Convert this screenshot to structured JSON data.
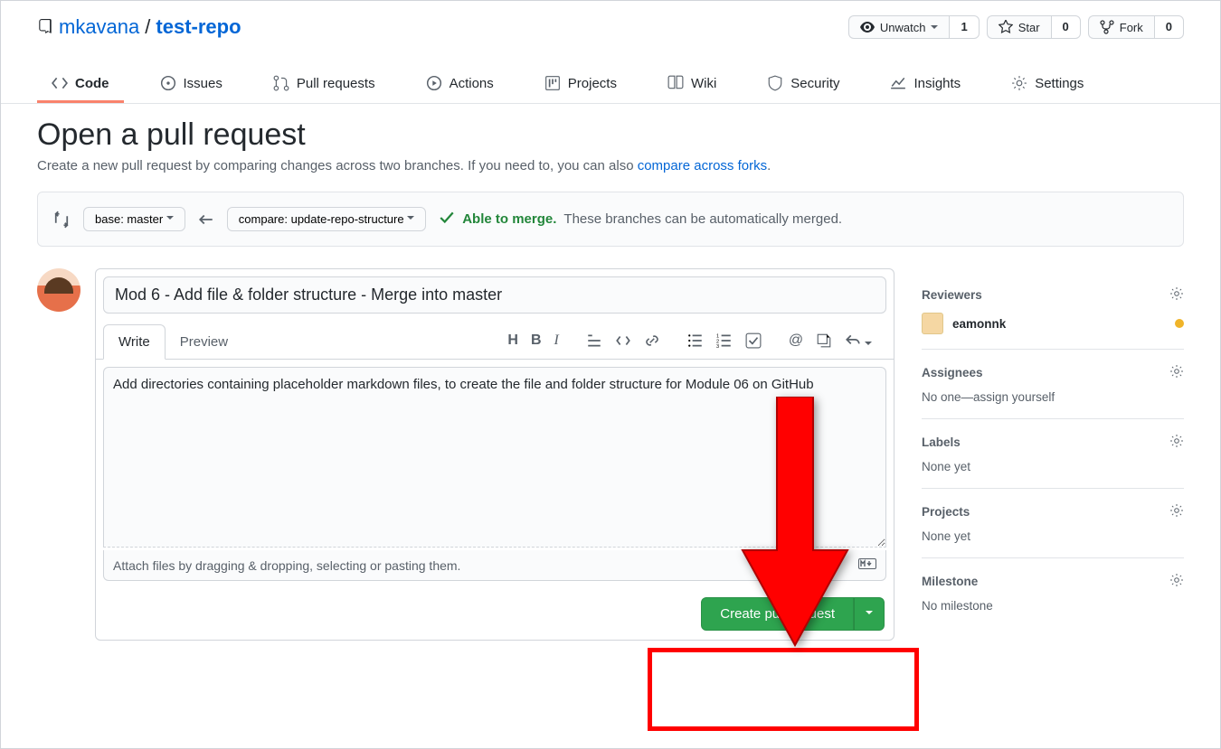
{
  "repo": {
    "owner": "mkavana",
    "name": "test-repo"
  },
  "actions": {
    "watch": {
      "label": "Unwatch",
      "count": "1"
    },
    "star": {
      "label": "Star",
      "count": "0"
    },
    "fork": {
      "label": "Fork",
      "count": "0"
    }
  },
  "tabs": {
    "code": "Code",
    "issues": "Issues",
    "pulls": "Pull requests",
    "actions": "Actions",
    "projects": "Projects",
    "wiki": "Wiki",
    "security": "Security",
    "insights": "Insights",
    "settings": "Settings"
  },
  "page": {
    "title": "Open a pull request",
    "subtitle_pre": "Create a new pull request by comparing changes across two branches. If you need to, you can also ",
    "subtitle_link": "compare across forks",
    "subtitle_post": "."
  },
  "compare": {
    "base_label": "base: master",
    "compare_label": "compare: update-repo-structure",
    "able": "Able to merge.",
    "rest": "These branches can be automatically merged."
  },
  "form": {
    "title_value": "Mod 6 - Add file & folder structure - Merge into master",
    "write": "Write",
    "preview": "Preview",
    "body_value": "Add directories containing placeholder markdown files, to create the file and folder structure for Module 06 on GitHub",
    "attach": "Attach files by dragging & dropping, selecting or pasting them.",
    "submit": "Create pull request"
  },
  "sidebar": {
    "reviewers_label": "Reviewers",
    "reviewer_name": "eamonnk",
    "assignees_label": "Assignees",
    "assignees_empty": "No one—assign yourself",
    "labels_label": "Labels",
    "labels_empty": "None yet",
    "projects_label": "Projects",
    "projects_empty": "None yet",
    "milestone_label": "Milestone",
    "milestone_empty": "No milestone"
  }
}
